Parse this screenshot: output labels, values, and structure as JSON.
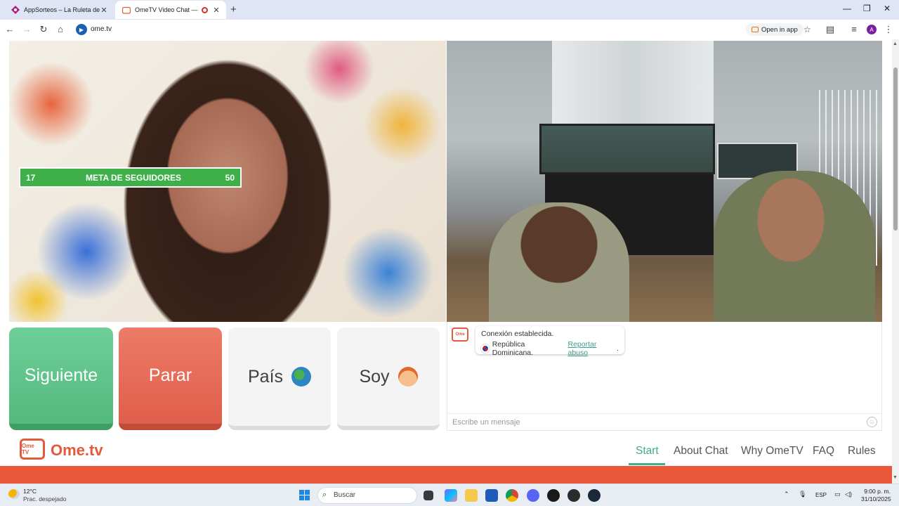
{
  "browser": {
    "tabs": [
      {
        "title": "AppSorteos – La Ruleta de la Su",
        "active": false
      },
      {
        "title": "OmeTV Video Chat — Ome",
        "active": true
      }
    ],
    "address": "ome.tv",
    "open_in_app": "Open in app"
  },
  "overlay": {
    "goal_current": "17",
    "goal_label": "META DE SEGUIDORES",
    "goal_target": "50"
  },
  "controls": {
    "next": "Siguiente",
    "stop": "Parar",
    "country": "País",
    "gender": "Soy"
  },
  "chat": {
    "status": "Conexión establecida.",
    "country": "República Dominicana.",
    "report": "Reportar abuso",
    "report_suffix": ".",
    "placeholder": "Escribe un mensaje"
  },
  "site_nav": {
    "brand": "Ome.tv",
    "logo_text": "Ome TV",
    "links": [
      "Start",
      "About Chat",
      "Why OmeTV",
      "FAQ",
      "Rules"
    ],
    "active_link": "Start"
  },
  "taskbar": {
    "temperature": "12°C",
    "condition": "Prac. despejado",
    "search": "Buscar",
    "language": "ESP",
    "time": "9:00 p. m.",
    "date": "31/10/2025"
  },
  "colors": {
    "next": "#5cc08a",
    "stop": "#e56a55",
    "brand": "#e45a3c",
    "accent": "#3fae8b",
    "goal_bar": "#3fb049"
  }
}
